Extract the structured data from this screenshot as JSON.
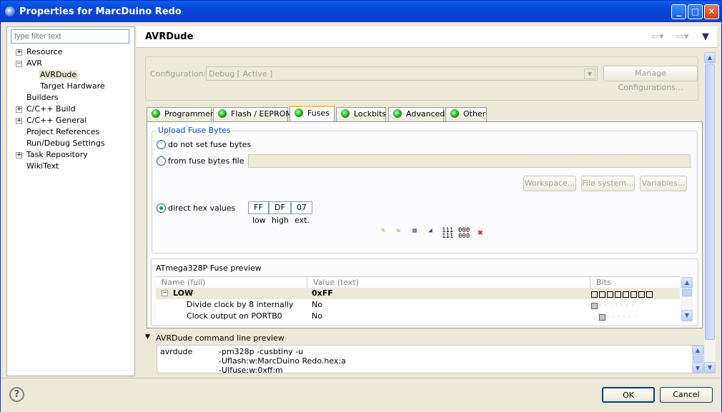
{
  "window": {
    "title": "Properties for MarcDuino Redo"
  },
  "filter": {
    "placeholder": "type filter text"
  },
  "tree": [
    {
      "label": "Resource",
      "expander": "+"
    },
    {
      "label": "AVR",
      "expander": "−"
    },
    {
      "label": "AVRDude",
      "selected": true
    },
    {
      "label": "Target Hardware"
    },
    {
      "label": "Builders"
    },
    {
      "label": "C/C++ Build",
      "expander": "+"
    },
    {
      "label": "C/C++ General",
      "expander": "+"
    },
    {
      "label": "Project References"
    },
    {
      "label": "Run/Debug Settings"
    },
    {
      "label": "Task Repository",
      "expander": "+"
    },
    {
      "label": "WikiText"
    }
  ],
  "page": {
    "title": "AVRDude"
  },
  "config": {
    "label": "Configuration:",
    "value": "Debug  [ Active ]",
    "manage_button": "Manage Configurations..."
  },
  "tabs": [
    "Programmer",
    "Flash / EEPROM",
    "Fuses",
    "Lockbits",
    "Advanced",
    "Other"
  ],
  "upload": {
    "group_title": "Upload Fuse Bytes",
    "opt_none": "do not set fuse bytes",
    "opt_file": "from fuse bytes file",
    "btn_workspace": "Workspace...",
    "btn_filesystem": "File system...",
    "btn_variables": "Variables...",
    "opt_direct": "direct hex values",
    "hex": [
      {
        "value": "FF",
        "label": "low"
      },
      {
        "value": "DF",
        "label": "high"
      },
      {
        "value": "07",
        "label": "ext."
      }
    ],
    "tool_glyphs": [
      "111\n111",
      "000\n000"
    ]
  },
  "preview": {
    "title": "ATmega328P  Fuse preview",
    "col_name": "Name (full)",
    "col_value": "Value (text)",
    "col_bits": "Bits",
    "rows": [
      {
        "name": "LOW",
        "value": "0xFF",
        "bold": true,
        "expander": "−"
      },
      {
        "name": "Divide clock by 8 internally",
        "value": "No"
      },
      {
        "name": "Clock output on PORTB0",
        "value": "No"
      }
    ]
  },
  "command": {
    "section_label": "AVRDude command line preview",
    "prog": "avrdude",
    "lines": [
      "-pm328p -cusbtiny -u",
      "-Uflash:w:MarcDuino Redo.hex:a",
      "-Ulfuse:w:0xff:m"
    ]
  },
  "buttons": {
    "ok": "OK",
    "cancel": "Cancel",
    "help": "?"
  }
}
